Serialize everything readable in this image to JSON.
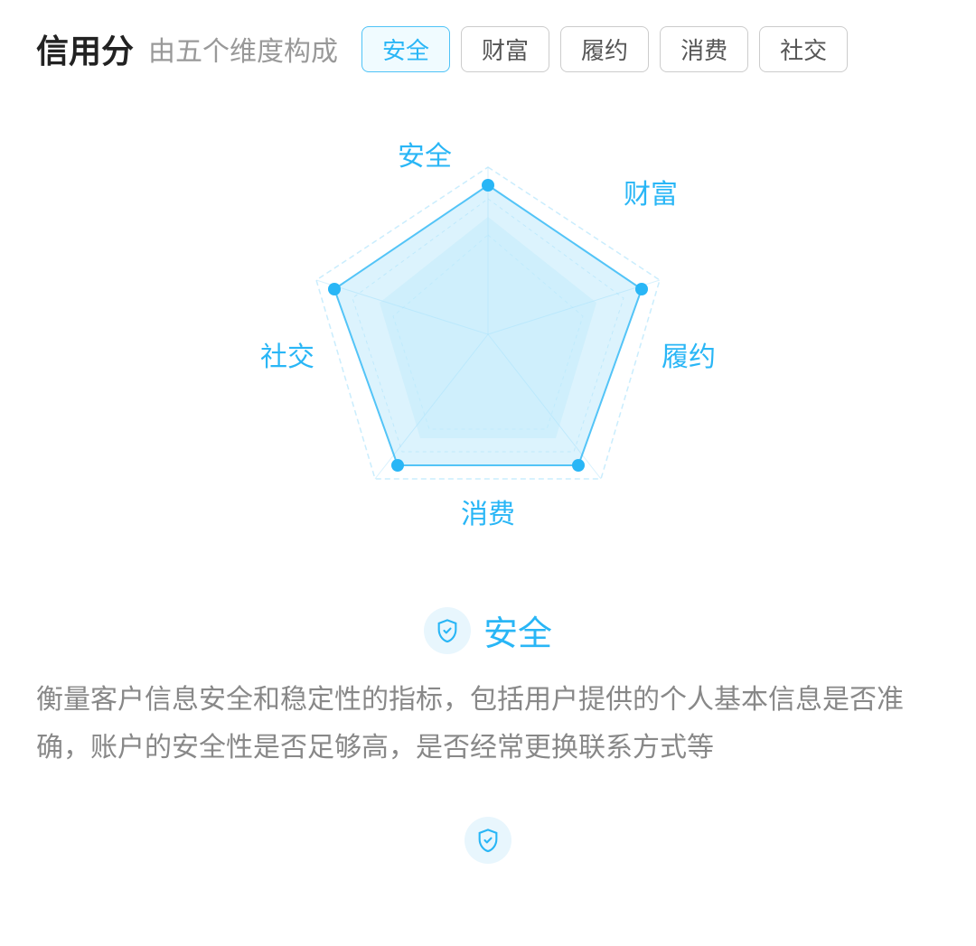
{
  "header": {
    "title": "信用分",
    "subtitle": "由五个维度构成",
    "tags": [
      {
        "label": "安全",
        "active": true
      },
      {
        "label": "财富",
        "active": false
      },
      {
        "label": "履约",
        "active": false
      },
      {
        "label": "消费",
        "active": false
      },
      {
        "label": "社交",
        "active": false
      }
    ]
  },
  "radar": {
    "labels": {
      "top": "安全",
      "top_right": "财富",
      "right": "履约",
      "bottom": "消费",
      "left": "社交"
    }
  },
  "info": {
    "icon_label": "shield-check-icon",
    "title": "安全",
    "description": "衡量客户信息安全和稳定性的指标，包括用户提供的个人基本信息是否准确，账户的安全性是否足够高，是否经常更换联系方式等"
  }
}
